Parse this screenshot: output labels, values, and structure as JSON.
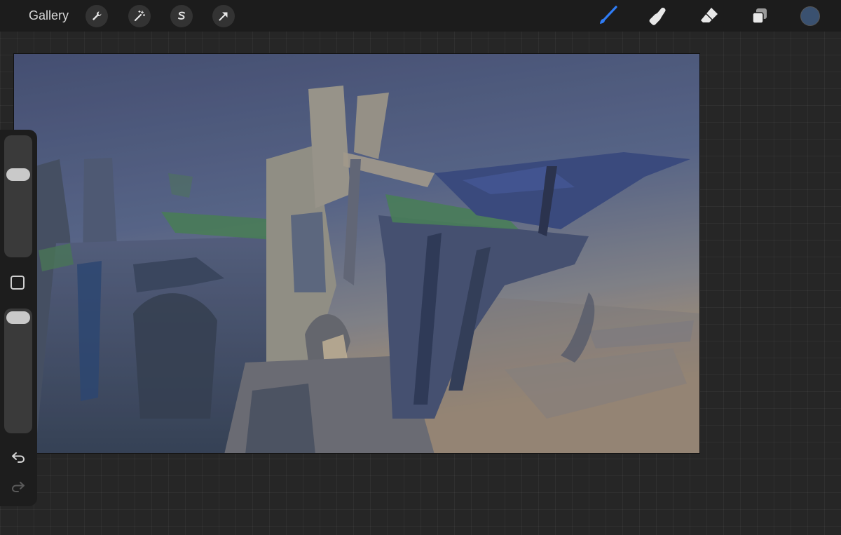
{
  "topbar": {
    "gallery_label": "Gallery",
    "left_tools": [
      {
        "name": "actions",
        "icon": "wrench-icon"
      },
      {
        "name": "adjustments",
        "icon": "magic-wand-icon"
      },
      {
        "name": "selection",
        "icon": "selection-s-icon"
      },
      {
        "name": "transform",
        "icon": "arrow-cursor-icon"
      }
    ],
    "right_tools": [
      {
        "name": "brush",
        "icon": "brush-icon",
        "active": true
      },
      {
        "name": "smudge",
        "icon": "smudge-finger-icon",
        "active": false
      },
      {
        "name": "eraser",
        "icon": "eraser-icon",
        "active": false
      },
      {
        "name": "layers",
        "icon": "layers-icon",
        "active": false
      }
    ],
    "current_color": "#3a5170",
    "active_tool_color": "#2f7cf5"
  },
  "sidebar": {
    "brush_size_level": 0.29,
    "opacity_level": 0.0,
    "modify_icon": "square-outline-icon",
    "undo_icon": "undo-arrow-icon",
    "redo_icon": "redo-arrow-icon",
    "redo_enabled": false
  },
  "canvas": {
    "content": "painting-sketch",
    "sky_top_color": "#4b5680",
    "sky_bottom_color": "#c6a073"
  }
}
